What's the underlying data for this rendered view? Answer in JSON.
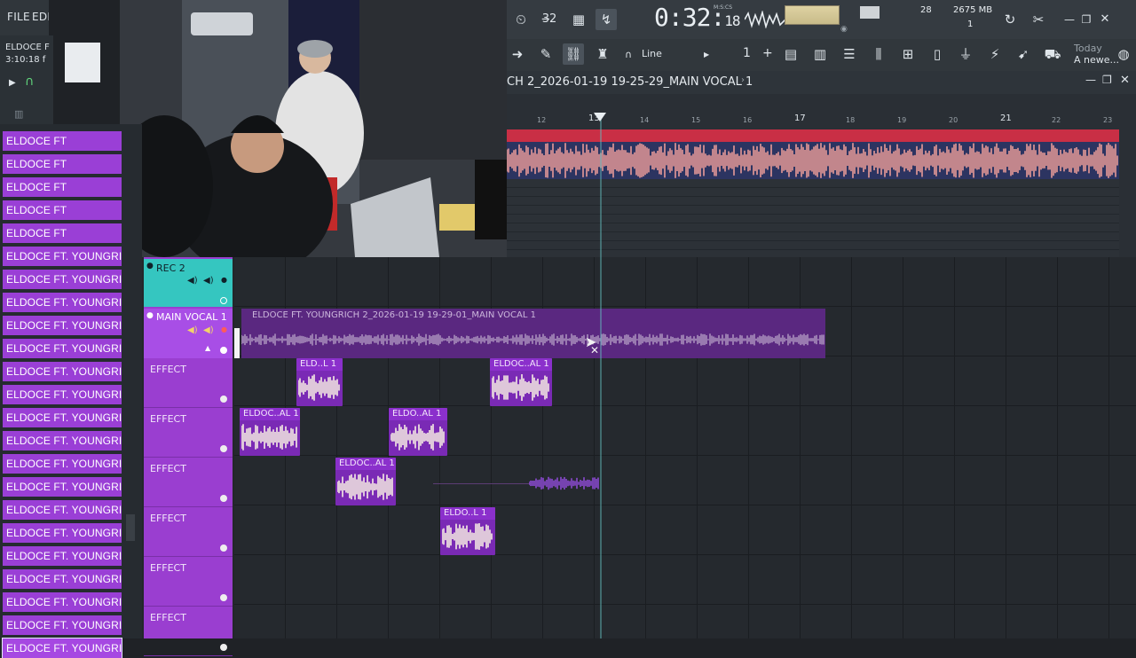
{
  "menu": {
    "file": "FILE",
    "edit": "EDI"
  },
  "project": {
    "name": "ELDOCE F",
    "length": "3:10:18 f"
  },
  "browser": {
    "items": [
      "ELDOCE FT",
      "ELDOCE FT",
      "ELDOCE FT",
      "ELDOCE FT",
      "ELDOCE FT",
      "ELDOCE FT. YOUNGRICH 2...",
      "ELDOCE FT. YOUNGRICH 2...",
      "ELDOCE FT. YOUNGRICH 2...",
      "ELDOCE FT. YOUNGRICH 2...",
      "ELDOCE FT. YOUNGRICH 2...",
      "ELDOCE FT. YOUNGRICH 2...",
      "ELDOCE FT. YOUNGRICH 2...",
      "ELDOCE FT. YOUNGRICH 2...",
      "ELDOCE FT. YOUNGRICH 2...",
      "ELDOCE FT. YOUNGRICH 2...",
      "ELDOCE FT. YOUNGRICH 2...",
      "ELDOCE FT. YOUNGRICH 2...",
      "ELDOCE FT. YOUNGRICH 2...",
      "ELDOCE FT. YOUNGRICH 2...",
      "ELDOCE FT. YOUNGRICH 2...",
      "ELDOCE FT. YOUNGRICH 2...",
      "ELDOCE FT. YOUNGRICH 2...",
      "ELDOCE FT. YOUNGRICH 2..."
    ],
    "selected_index": 22
  },
  "toolbar": {
    "time_main": "0:32",
    "time_sub": "18",
    "time_format": "M:S:CS",
    "polyphony": "28",
    "memory": "2675 MB",
    "memory_sub": "1",
    "snap_label": "Line",
    "step_value": "1",
    "step_plus": "+",
    "hint_time": "Today",
    "hint_text": "A newe..."
  },
  "editor": {
    "title": "CH 2_2026-01-19 19-25-29_MAIN VOCAL 1",
    "ruler": [
      "12",
      "13",
      "14",
      "15",
      "16",
      "17",
      "18",
      "19",
      "20",
      "21",
      "22",
      "23"
    ]
  },
  "playlist": {
    "tracks": [
      {
        "name": "REC 2"
      },
      {
        "name": "MAIN VOCAL 1"
      },
      {
        "name": "EFFECT"
      },
      {
        "name": "EFFECT"
      },
      {
        "name": "EFFECT"
      },
      {
        "name": "EFFECT"
      },
      {
        "name": "EFFECT"
      },
      {
        "name": "EFFECT"
      }
    ],
    "main_clip": "ELDOCE FT. YOUNGRICH 2_2026-01-19 19-29-01_MAIN VOCAL 1",
    "clips": [
      {
        "label": "ELD..L 1"
      },
      {
        "label": "ELDOC..AL 1"
      },
      {
        "label": "ELDOC..AL 1"
      },
      {
        "label": "ELDO..AL 1"
      },
      {
        "label": "ELDOC..AL 1"
      },
      {
        "label": "ELDO..L 1"
      }
    ]
  },
  "colors": {
    "accent": "#9a3fd6",
    "rec_track": "#35c6c0",
    "editor_strip": "#c92f45",
    "wave_editor": "#2c3461"
  }
}
